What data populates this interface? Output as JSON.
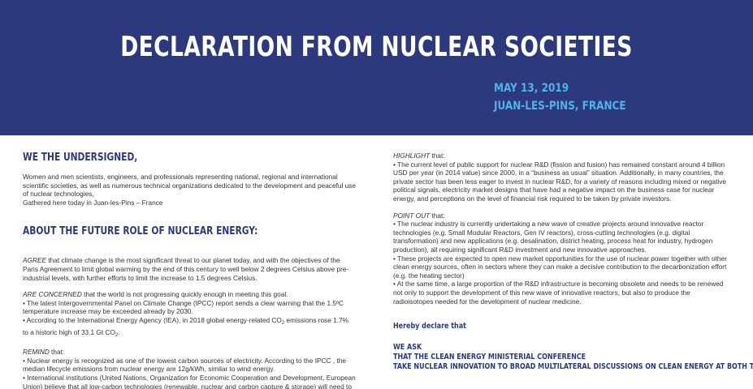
{
  "header": {
    "title": "DECLARATION FROM NUCLEAR SOCIETIES",
    "date": "MAY 13, 2019",
    "location": "JUAN-LES-PINS, FRANCE"
  },
  "left": {
    "undersigned_heading": "WE THE UNDERSIGNED,",
    "intro_1": "Women and men scientists, engineers, and professionals representing national, regional and international scientific societies, as well as numerous technical organizations dedicated to the development and peaceful use of nuclear technologies,",
    "intro_2": "Gathered here today in Juan-les-Pins – France",
    "future_heading": "ABOUT THE FUTURE ROLE OF NUCLEAR ENERGY:",
    "agree_kw": "AGREE",
    "agree_text": " that climate change is the most significant threat to our planet today, and with the objectives of the Paris Agreement to limit global warming by the end of this century to well below 2 degrees Celsius above pre-industrial levels, with further efforts to limit the increase to 1.5 degrees Celsius.",
    "concerned_kw": "ARE CONCERNED",
    "concerned_text": " that the world is not progressing quickly enough in meeting this goal.",
    "concerned_b1": "• The latest Intergovernmental Panel on Climate Change (IPCC) report  sends a clear warning that the 1.5ºC temperature increase may be exceeded already by 2030.",
    "concerned_b2_a": "• According to the International Energy Agency (IEA), in 2018 global energy-related CO",
    "concerned_b2_sub": "2",
    "concerned_b2_b": " emissions rose 1.7% to a historic high of 33.1 Gt CO",
    "concerned_b2_sub2": "2",
    "concerned_b2_c": ".",
    "remind_kw": "REMIND",
    "remind_text": " that:",
    "remind_b1": "• Nuclear energy is recognized as one of the lowest carbon sources of electricity.  According to the IPCC , the median lifecycle emissions from nuclear energy are 12g/kWh, similar to wind energy.",
    "remind_b2": "• International institutions (United Nations, Organization for Economic Cooperation and Development, European Union) believe that all low-carbon technologies (renewable, nuclear and carbon capture & storage) will need to be implemented in order to achieve deep decarbonization by the middle of this century. This is"
  },
  "right": {
    "highlight_kw": "HIGHLIGHT",
    "highlight_text": " that:",
    "highlight_b1": "• The current level of public support for nuclear R&D (fission and fusion) has remained constant around 4 billion USD per year (in 2014 value) since 2000, in a “business as usual” situation. Additionally, in many countries, the private sector has been less eager to invest in nuclear R&D, for a variety of reasons including mixed or negative political signals, electricity market designs that have had a negative impact on the business case for nuclear energy, and perceptions on the level of financial risk required to be taken by private investors.",
    "pointout_kw": "POINT OUT",
    "pointout_text": " that:",
    "pointout_b1": "• The nuclear industry is currently undertaking a new wave of creative projects around innovative reactor technologies (e.g. Small Modular Reactors, Gen IV reactors), cross-cutting technologies (e.g. digital transformation) and new applications (e.g. desalination, district heating, process heat for industry, hydrogen production), all requiring significant R&D investment and new innovative approaches.",
    "pointout_b2": "• These projects are expected to open new market opportunities for the use of nuclear power together with other clean energy sources, often in sectors where they can make a decisive contribution to the decarbonization effort (e.g. the heating sector)",
    "pointout_b3": "• At the same time, a large proportion of the R&D infrastructure is becoming obsolete and needs to be renewed not only to support the development of this new wave of innovative reactors, but also to produce the radioisotopes needed for the development of nuclear medicine.",
    "declare_heading": "Hereby declare that",
    "ask_heading": "WE ASK",
    "ask_line2": "THAT THE CLEAN ENERGY MINISTERIAL CONFERENCE",
    "ask_line3": "TAKE NUCLEAR INNOVATION TO BROAD MULTILATERAL DISCUSSIONS ON CLEAN ENERGY AT BOTH THE MINIS-"
  }
}
